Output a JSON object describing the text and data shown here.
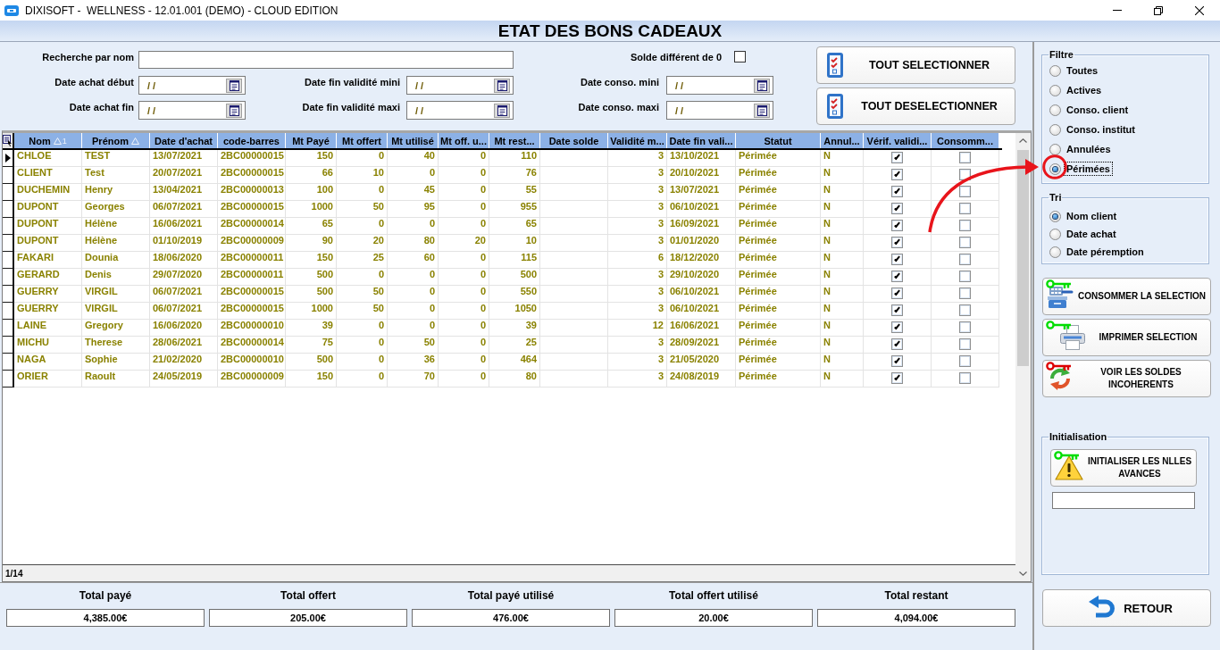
{
  "window": {
    "title": "DIXISOFT -  WELLNESS - 12.01.001 (DEMO) - CLOUD EDITION"
  },
  "heading": "ETAT DES BONS CADEAUX",
  "filters": {
    "search": {
      "label": "Recherche par nom"
    },
    "balance": {
      "label": "Solde différent de 0",
      "checked": false
    },
    "date_rows": [
      [
        {
          "label": "Date achat début",
          "value": "/ /"
        },
        {
          "label": "Date fin validité mini",
          "value": "/ /"
        },
        {
          "label": "Date conso. mini",
          "value": "/ /"
        }
      ],
      [
        {
          "label": "Date achat fin",
          "value": "/ /"
        },
        {
          "label": "Date fin validité maxi",
          "value": "/ /"
        },
        {
          "label": "Date conso. maxi",
          "value": "/ /"
        }
      ]
    ]
  },
  "selection_buttons": [
    {
      "label": "TOUT SELECTIONNER"
    },
    {
      "label": "TOUT DESELECTIONNER"
    }
  ],
  "table": {
    "columns": [
      {
        "label": "Nom",
        "kind": "text",
        "sorted": true,
        "sort_rank": "1"
      },
      {
        "label": "Prénom",
        "kind": "text",
        "sorted": true
      },
      {
        "label": "Date d'achat",
        "kind": "text"
      },
      {
        "label": "code-barres",
        "kind": "text"
      },
      {
        "label": "Mt Payé",
        "kind": "number"
      },
      {
        "label": "Mt offert",
        "kind": "number"
      },
      {
        "label": "Mt utilisé",
        "kind": "number"
      },
      {
        "label": "Mt off. u...",
        "kind": "number"
      },
      {
        "label": "Mt rest...",
        "kind": "number"
      },
      {
        "label": "Date solde",
        "kind": "text"
      },
      {
        "label": "Validité m...",
        "kind": "number"
      },
      {
        "label": "Date fin vali...",
        "kind": "text"
      },
      {
        "label": "Statut",
        "kind": "text"
      },
      {
        "label": "Annul...",
        "kind": "text"
      },
      {
        "label": "Vérif. validi...",
        "kind": "check"
      },
      {
        "label": "Consomm...",
        "kind": "check"
      }
    ],
    "rows": [
      {
        "selected": true,
        "cells": [
          "CHLOE",
          "TEST",
          "13/07/2021",
          "2BC00000015",
          "150",
          "0",
          "40",
          "0",
          "110",
          "",
          "3",
          "13/10/2021",
          "Périmée",
          "N"
        ],
        "checks": [
          {
            "checked": true
          },
          {
            "checked": false
          }
        ]
      },
      {
        "selected": false,
        "cells": [
          "CLIENT",
          "Test",
          "20/07/2021",
          "2BC00000015",
          "66",
          "10",
          "0",
          "0",
          "76",
          "",
          "3",
          "20/10/2021",
          "Périmée",
          "N"
        ],
        "checks": [
          {
            "checked": true
          },
          {
            "checked": false
          }
        ]
      },
      {
        "selected": false,
        "cells": [
          "DUCHEMIN",
          "Henry",
          "13/04/2021",
          "2BC00000013",
          "100",
          "0",
          "45",
          "0",
          "55",
          "",
          "3",
          "13/07/2021",
          "Périmée",
          "N"
        ],
        "checks": [
          {
            "checked": true
          },
          {
            "checked": false
          }
        ]
      },
      {
        "selected": false,
        "cells": [
          "DUPONT",
          "Georges",
          "06/07/2021",
          "2BC00000015",
          "1000",
          "50",
          "95",
          "0",
          "955",
          "",
          "3",
          "06/10/2021",
          "Périmée",
          "N"
        ],
        "checks": [
          {
            "checked": true
          },
          {
            "checked": false
          }
        ]
      },
      {
        "selected": false,
        "cells": [
          "DUPONT",
          "Hélène",
          "16/06/2021",
          "2BC00000014",
          "65",
          "0",
          "0",
          "0",
          "65",
          "",
          "3",
          "16/09/2021",
          "Périmée",
          "N"
        ],
        "checks": [
          {
            "checked": true
          },
          {
            "checked": false
          }
        ]
      },
      {
        "selected": false,
        "cells": [
          "DUPONT",
          "Hélène",
          "01/10/2019",
          "2BC00000009",
          "90",
          "20",
          "80",
          "20",
          "10",
          "",
          "3",
          "01/01/2020",
          "Périmée",
          "N"
        ],
        "checks": [
          {
            "checked": true
          },
          {
            "checked": false
          }
        ]
      },
      {
        "selected": false,
        "cells": [
          "FAKARI",
          "Dounia",
          "18/06/2020",
          "2BC00000011",
          "150",
          "25",
          "60",
          "0",
          "115",
          "",
          "6",
          "18/12/2020",
          "Périmée",
          "N"
        ],
        "checks": [
          {
            "checked": true
          },
          {
            "checked": false
          }
        ]
      },
      {
        "selected": false,
        "cells": [
          "GERARD",
          "Denis",
          "29/07/2020",
          "2BC00000011",
          "500",
          "0",
          "0",
          "0",
          "500",
          "",
          "3",
          "29/10/2020",
          "Périmée",
          "N"
        ],
        "checks": [
          {
            "checked": true
          },
          {
            "checked": false
          }
        ]
      },
      {
        "selected": false,
        "cells": [
          "GUERRY",
          "VIRGIL",
          "06/07/2021",
          "2BC00000015",
          "500",
          "50",
          "0",
          "0",
          "550",
          "",
          "3",
          "06/10/2021",
          "Périmée",
          "N"
        ],
        "checks": [
          {
            "checked": true
          },
          {
            "checked": false
          }
        ]
      },
      {
        "selected": false,
        "cells": [
          "GUERRY",
          "VIRGIL",
          "06/07/2021",
          "2BC00000015",
          "1000",
          "50",
          "0",
          "0",
          "1050",
          "",
          "3",
          "06/10/2021",
          "Périmée",
          "N"
        ],
        "checks": [
          {
            "checked": true
          },
          {
            "checked": false
          }
        ]
      },
      {
        "selected": false,
        "cells": [
          "LAINE",
          "Gregory",
          "16/06/2020",
          "2BC00000010",
          "39",
          "0",
          "0",
          "0",
          "39",
          "",
          "12",
          "16/06/2021",
          "Périmée",
          "N"
        ],
        "checks": [
          {
            "checked": true
          },
          {
            "checked": false
          }
        ]
      },
      {
        "selected": false,
        "cells": [
          "MICHU",
          "Therese",
          "28/06/2021",
          "2BC00000014",
          "75",
          "0",
          "50",
          "0",
          "25",
          "",
          "3",
          "28/09/2021",
          "Périmée",
          "N"
        ],
        "checks": [
          {
            "checked": true
          },
          {
            "checked": false
          }
        ]
      },
      {
        "selected": false,
        "cells": [
          "NAGA",
          "Sophie",
          "21/02/2020",
          "2BC00000010",
          "500",
          "0",
          "36",
          "0",
          "464",
          "",
          "3",
          "21/05/2020",
          "Périmée",
          "N"
        ],
        "checks": [
          {
            "checked": true
          },
          {
            "checked": false
          }
        ]
      },
      {
        "selected": false,
        "cells": [
          "ORIER",
          "Raoult",
          "24/05/2019",
          "2BC00000009",
          "150",
          "0",
          "70",
          "0",
          "80",
          "",
          "3",
          "24/08/2019",
          "Périmée",
          "N"
        ],
        "checks": [
          {
            "checked": true
          },
          {
            "checked": false
          }
        ]
      }
    ],
    "record_count": "1/14"
  },
  "totals": [
    {
      "label": "Total payé",
      "value": "4,385.00€"
    },
    {
      "label": "Total offert",
      "value": "205.00€"
    },
    {
      "label": "Total payé utilisé",
      "value": "476.00€"
    },
    {
      "label": "Total offert utilisé",
      "value": "20.00€"
    },
    {
      "label": "Total restant",
      "value": "4,094.00€"
    }
  ],
  "filter_group": {
    "title": "Filtre",
    "options": [
      {
        "label": "Toutes",
        "selected": false,
        "focused": false
      },
      {
        "label": "Actives",
        "selected": false,
        "focused": false
      },
      {
        "label": "Conso. client",
        "selected": false,
        "focused": false
      },
      {
        "label": "Conso. institut",
        "selected": false,
        "focused": false
      },
      {
        "label": "Annulées",
        "selected": false,
        "focused": false
      },
      {
        "label": "Périmées",
        "selected": true,
        "focused": true
      }
    ]
  },
  "sort_group": {
    "title": "Tri",
    "options": [
      {
        "label": "Nom client",
        "selected": true
      },
      {
        "label": "Date achat",
        "selected": false
      },
      {
        "label": "Date péremption",
        "selected": false
      }
    ]
  },
  "action_buttons": [
    {
      "label": "CONSOMMER LA SELECTION",
      "kind": "consume",
      "color": "#00dd00"
    },
    {
      "label": "IMPRIMER SELECTION",
      "kind": "print",
      "color": "#00dd00"
    },
    {
      "label": "VOIR LES SOLDES INCOHERENTS",
      "kind": "inconsistent",
      "color": "#dd0000"
    }
  ],
  "initialisation": {
    "title": "Initialisation",
    "button": {
      "label": "INITIALISER LES NLLES AVANCES",
      "color": "#00dd00"
    }
  },
  "back_button": {
    "label": "RETOUR"
  },
  "annotation": {
    "circle": true,
    "arrow": true
  }
}
